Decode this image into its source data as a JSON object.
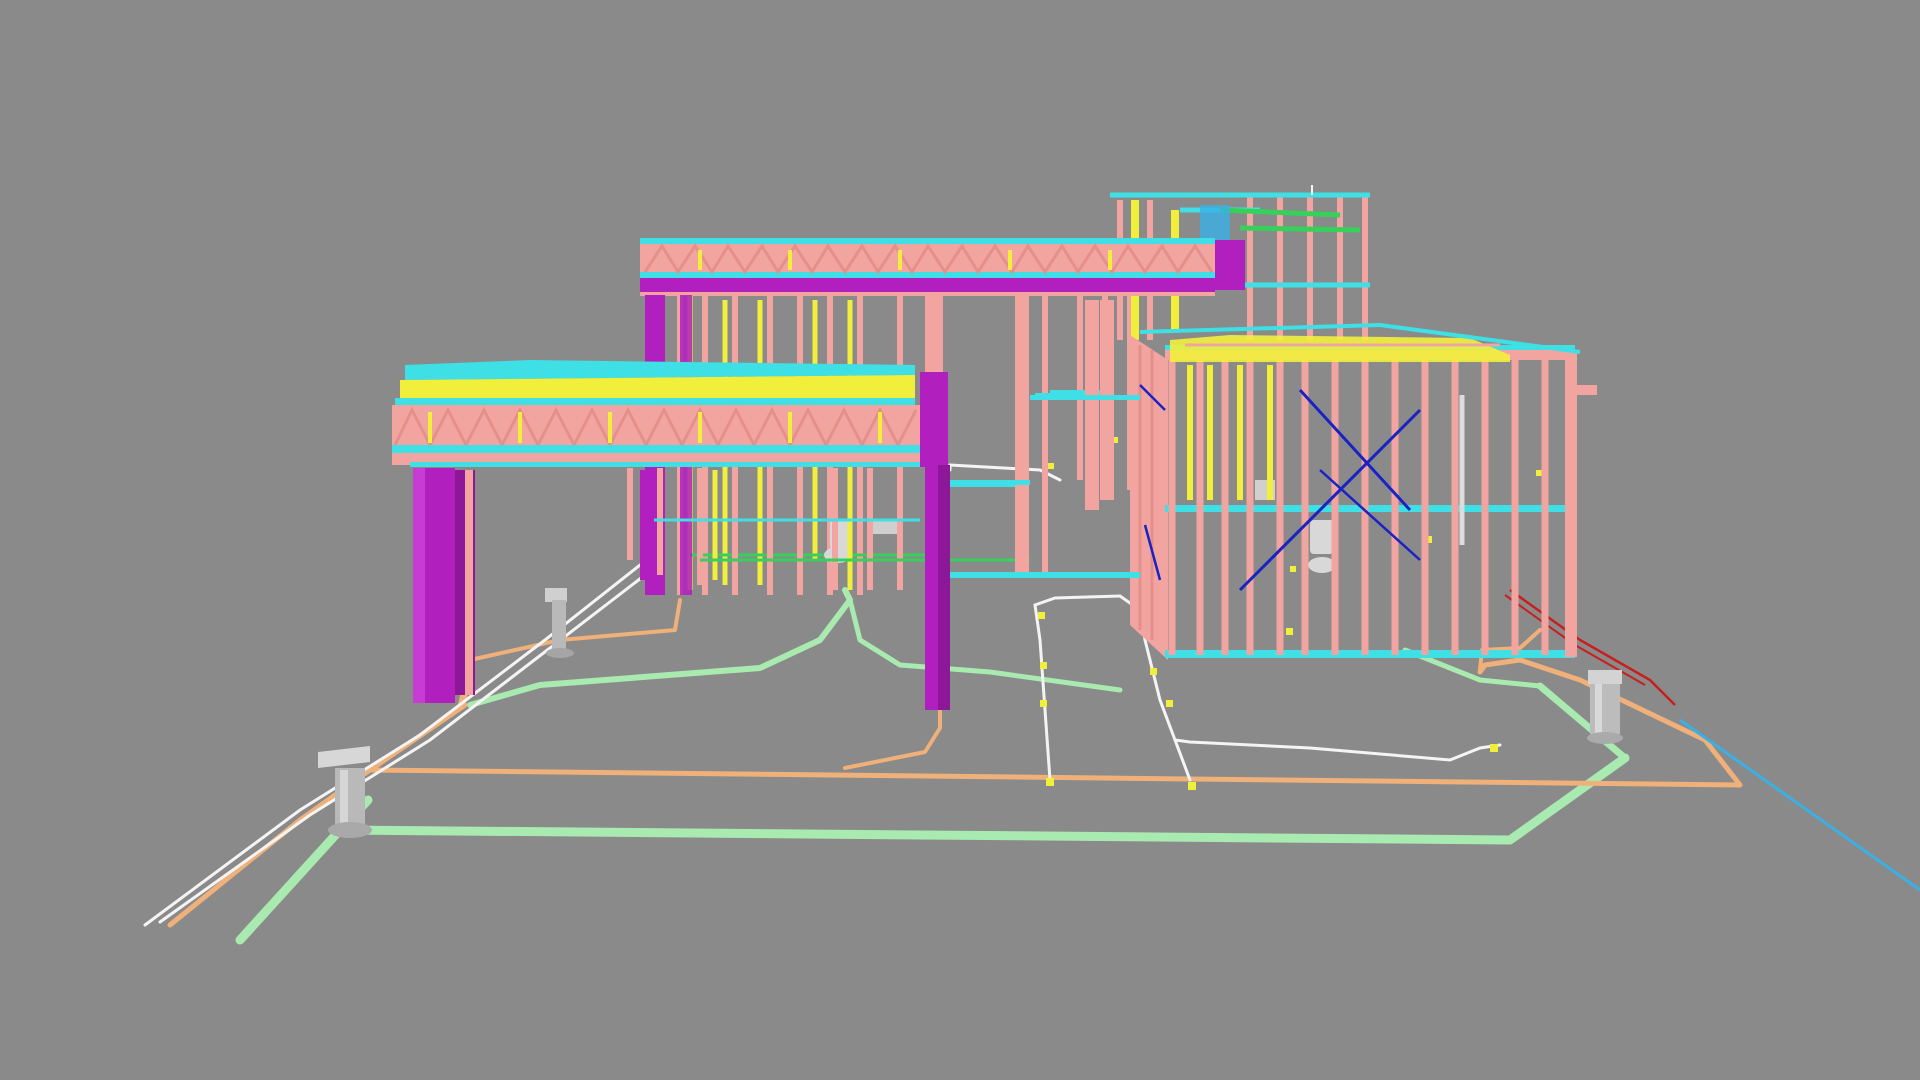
{
  "viewport": {
    "background": "#8a8a8a"
  },
  "palette": {
    "stud_pink": "#f2a5a0",
    "stud_pink_dark": "#e58f8a",
    "purple": "#b21fbf",
    "purple_dark": "#8e1799",
    "cyan": "#3ee0e6",
    "yellow": "#f2ef3c",
    "green": "#36d15a",
    "blue": "#1b22c4",
    "light_blue": "#3ab0e6",
    "pipe_orange": "#f0b07a",
    "pipe_green": "#a8eab0",
    "wire_white": "#f4f4f4",
    "fixture_gray": "#c7c7c7",
    "red_line": "#c81e1e",
    "junction_yellow": "#f0f03a"
  },
  "icons": {
    "model": "building-frame-model-icon"
  }
}
